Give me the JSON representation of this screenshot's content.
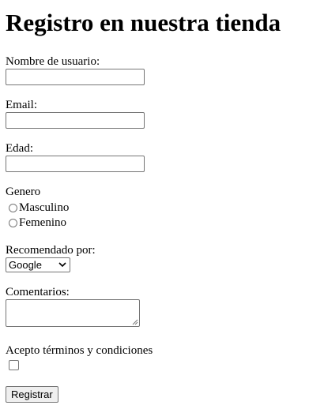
{
  "title": "Registro en nuestra tienda",
  "fields": {
    "username_label": "Nombre de usuario:",
    "username_value": "",
    "email_label": "Email:",
    "email_value": "",
    "age_label": "Edad:",
    "age_value": ""
  },
  "gender": {
    "label": "Genero",
    "options": [
      "Masculino",
      "Femenino"
    ]
  },
  "recommended": {
    "label": "Recomendado por:",
    "selected": "Google"
  },
  "comments": {
    "label": "Comentarios:",
    "value": ""
  },
  "terms": {
    "label": "Acepto términos y condiciones"
  },
  "submit_label": "Registrar"
}
